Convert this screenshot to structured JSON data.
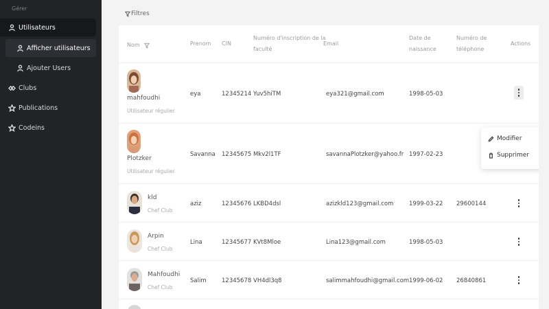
{
  "sidebar": {
    "section_label": "Gérer",
    "items": [
      {
        "label": "Utilisateurs",
        "icon": "users-icon"
      },
      {
        "label": "Afficher utilisateurs",
        "icon": "users-icon"
      },
      {
        "label": "Ajouter Users",
        "icon": "user-icon"
      },
      {
        "label": "Clubs",
        "icon": "clubs-icon"
      },
      {
        "label": "Publications",
        "icon": "star-icon"
      },
      {
        "label": "Codeins",
        "icon": "star-icon"
      }
    ]
  },
  "filters_label": "Filtres",
  "table": {
    "headers": {
      "nom": "Nom",
      "prenom": "Prenom",
      "cin": "CIN",
      "inscription_1": "Numéro d'inscription de la",
      "inscription_2": "faculté",
      "email": "Email",
      "dob_1": "Date de",
      "dob_2": "naissance",
      "tel_1": "Numéro de",
      "tel_2": "téléphone",
      "actions": "Actions"
    },
    "rows": [
      {
        "name": "mahfoudhi",
        "role": "Utilisateur régulier",
        "prenom": "eya",
        "cin": "12345214",
        "inscription": "Yuv5hiTM",
        "email": "eya321@gmail.com",
        "dob": "1998-05-03",
        "tel": ""
      },
      {
        "name": "Plotzker",
        "role": "Utilisateur régulier",
        "prenom": "Savanna",
        "cin": "12345675",
        "inscription": "Mkv2l1TF",
        "email": "savannaPlotzker@yahoo.fr",
        "dob": "1997-02-23",
        "tel": ""
      },
      {
        "name": "kld",
        "role": "Chef Club",
        "prenom": "aziz",
        "cin": "12345676",
        "inscription": "LKBD4dsl",
        "email": "azizkld123@gmail.com",
        "dob": "1999-03-22",
        "tel": "29600144"
      },
      {
        "name": "Arpin",
        "role": "Chef Club",
        "prenom": "Lina",
        "cin": "12345677",
        "inscription": "KVt8Mloe",
        "email": "Lina123@gmail.com",
        "dob": "1998-05-03",
        "tel": ""
      },
      {
        "name": "Mahfoudhi",
        "role": "Chef Club",
        "prenom": "Salim",
        "cin": "12345678",
        "inscription": "VH4dl3q8",
        "email": "salimmahfoudhi@gmail.com",
        "dob": "1999-06-02",
        "tel": "26840861"
      }
    ]
  },
  "row_menu": {
    "modify_label": "Modifier",
    "delete_label": "Supprimer"
  }
}
